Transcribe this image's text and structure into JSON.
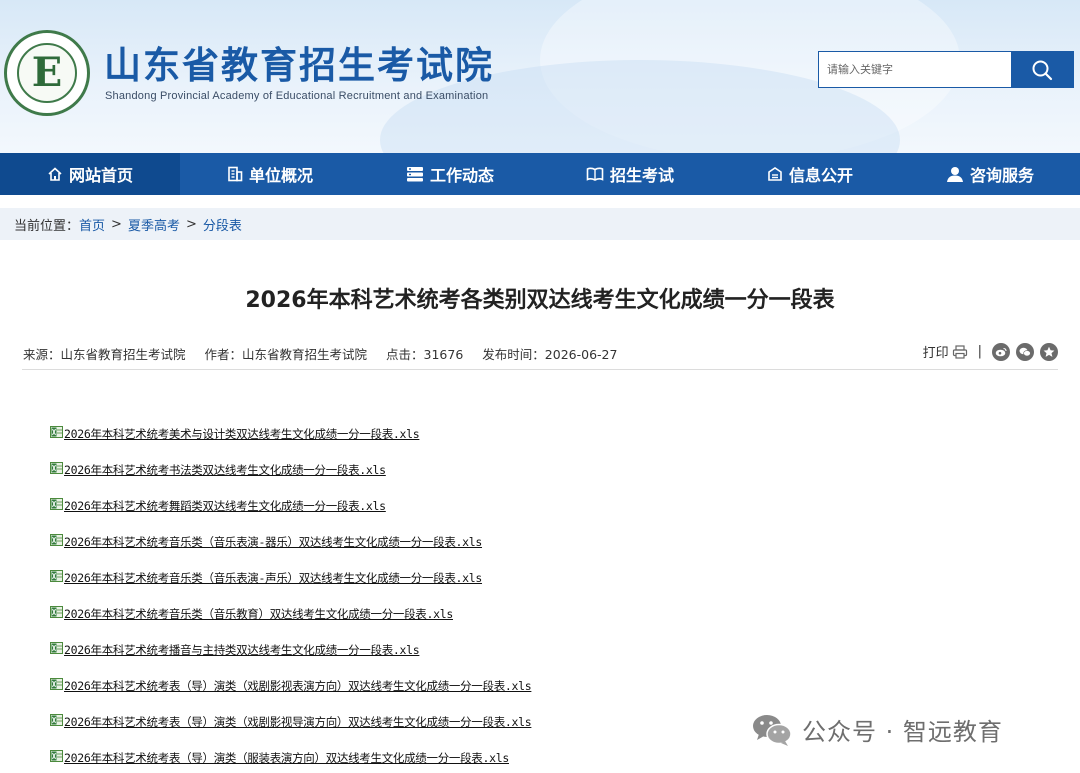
{
  "header": {
    "title": "山东省教育招生考试院",
    "subtitle": "Shandong Provincial Academy of Educational Recruitment and Examination",
    "logo_letter": "E",
    "search_placeholder": "请输入关键字",
    "search_icon": "search-icon"
  },
  "nav": {
    "items": [
      {
        "label": "网站首页",
        "icon": "home-icon"
      },
      {
        "label": "单位概况",
        "icon": "building-icon"
      },
      {
        "label": "工作动态",
        "icon": "news-icon"
      },
      {
        "label": "招生考试",
        "icon": "book-icon"
      },
      {
        "label": "信息公开",
        "icon": "info-icon"
      },
      {
        "label": "咨询服务",
        "icon": "user-icon"
      }
    ]
  },
  "breadcrumb": {
    "label": "当前位置：",
    "items": [
      "首页",
      "夏季高考",
      "分段表"
    ],
    "separator": ">"
  },
  "article": {
    "title": "2026年本科艺术统考各类别双达线考生文化成绩一分一段表",
    "meta": {
      "source": "来源：山东省教育招生考试院",
      "author": "作者：山东省教育招生考试院",
      "clicks": "点击：31676",
      "date": "发布时间：2026-06-27"
    },
    "print_label": "打印",
    "pipe": "|",
    "files": [
      "2026年本科艺术统考美术与设计类双达线考生文化成绩一分一段表.xls",
      "2026年本科艺术统考书法类双达线考生文化成绩一分一段表.xls",
      "2026年本科艺术统考舞蹈类双达线考生文化成绩一分一段表.xls",
      "2026年本科艺术统考音乐类（音乐表演-器乐）双达线考生文化成绩一分一段表.xls",
      "2026年本科艺术统考音乐类（音乐表演-声乐）双达线考生文化成绩一分一段表.xls",
      "2026年本科艺术统考音乐类（音乐教育）双达线考生文化成绩一分一段表.xls",
      "2026年本科艺术统考播音与主持类双达线考生文化成绩一分一段表.xls",
      "2026年本科艺术统考表（导）演类（戏剧影视表演方向）双达线考生文化成绩一分一段表.xls",
      "2026年本科艺术统考表（导）演类（戏剧影视导演方向）双达线考生文化成绩一分一段表.xls",
      "2026年本科艺术统考表（导）演类（服装表演方向）双达线考生文化成绩一分一段表.xls"
    ]
  },
  "watermark": {
    "text": "公众号 · 智远教育",
    "icon": "wechat-icon"
  },
  "colors": {
    "brand_blue": "#1a5aa6",
    "nav_active": "#0f4a8f",
    "breadcrumb_bg": "#edf2f8",
    "logo_green": "#3f7a4a"
  }
}
